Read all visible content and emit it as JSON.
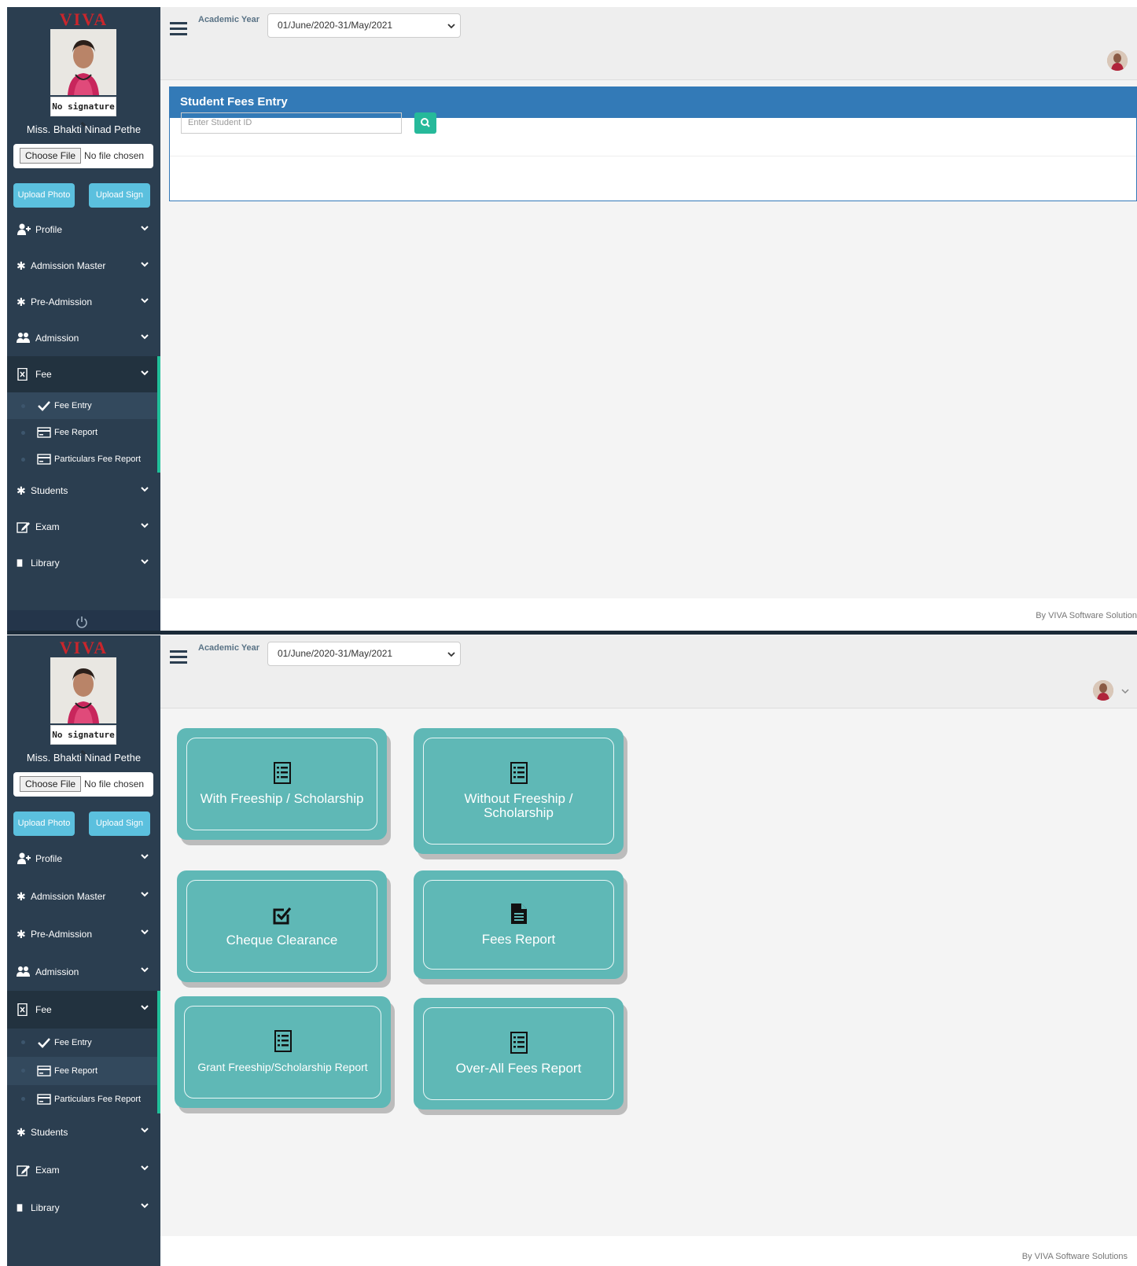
{
  "brand": "VIVA",
  "user": {
    "name": "Miss. Bhakti Ninad Pethe",
    "signature_label": "No signature"
  },
  "upload": {
    "choose_file": "Choose File",
    "no_file": "No file chosen",
    "upload_photo": "Upload Photo",
    "upload_sign": "Upload Sign"
  },
  "topbar": {
    "academic_year_label": "Academic Year",
    "academic_year_value": "01/June/2020-31/May/2021"
  },
  "sidebar": {
    "items": [
      {
        "label": "Profile",
        "icon": "add-user-icon"
      },
      {
        "label": "Admission Master",
        "icon": "asterisk-icon"
      },
      {
        "label": "Pre-Admission",
        "icon": "asterisk-icon"
      },
      {
        "label": "Admission",
        "icon": "users-icon"
      },
      {
        "label": "Fee",
        "icon": "document-icon"
      },
      {
        "label": "Students",
        "icon": "asterisk-icon"
      },
      {
        "label": "Exam",
        "icon": "edit-icon"
      },
      {
        "label": "Library",
        "icon": "book-icon"
      }
    ],
    "fee_sub": [
      {
        "label": "Fee Entry",
        "icon": "check-icon"
      },
      {
        "label": "Fee Report",
        "icon": "card-icon"
      },
      {
        "label": "Particulars Fee Report",
        "icon": "card-icon"
      }
    ]
  },
  "fees_entry": {
    "title": "Student Fees Entry",
    "placeholder": "Enter Student ID"
  },
  "tiles": [
    {
      "label": "With Freeship / Scholarship",
      "icon": "list-icon"
    },
    {
      "label": "Without Freeship / Scholarship",
      "icon": "list-icon"
    },
    {
      "label": "Cheque Clearance",
      "icon": "check-square-icon"
    },
    {
      "label": "Fees Report",
      "icon": "file-icon"
    },
    {
      "label": "Grant Freeship/Scholarship Report",
      "icon": "list-icon"
    },
    {
      "label": "Over-All Fees Report",
      "icon": "list-icon"
    }
  ],
  "footer": {
    "panel1": "By VIVA Software Solution",
    "panel2": "By VIVA Software Solutions"
  },
  "colors": {
    "sidebar": "#2b3e50",
    "accent": "#21c09a",
    "header_blue": "#337ab7",
    "tile": "#5fb8b6",
    "upload_btn": "#5bc0de",
    "brand_red": "#c9262c"
  }
}
